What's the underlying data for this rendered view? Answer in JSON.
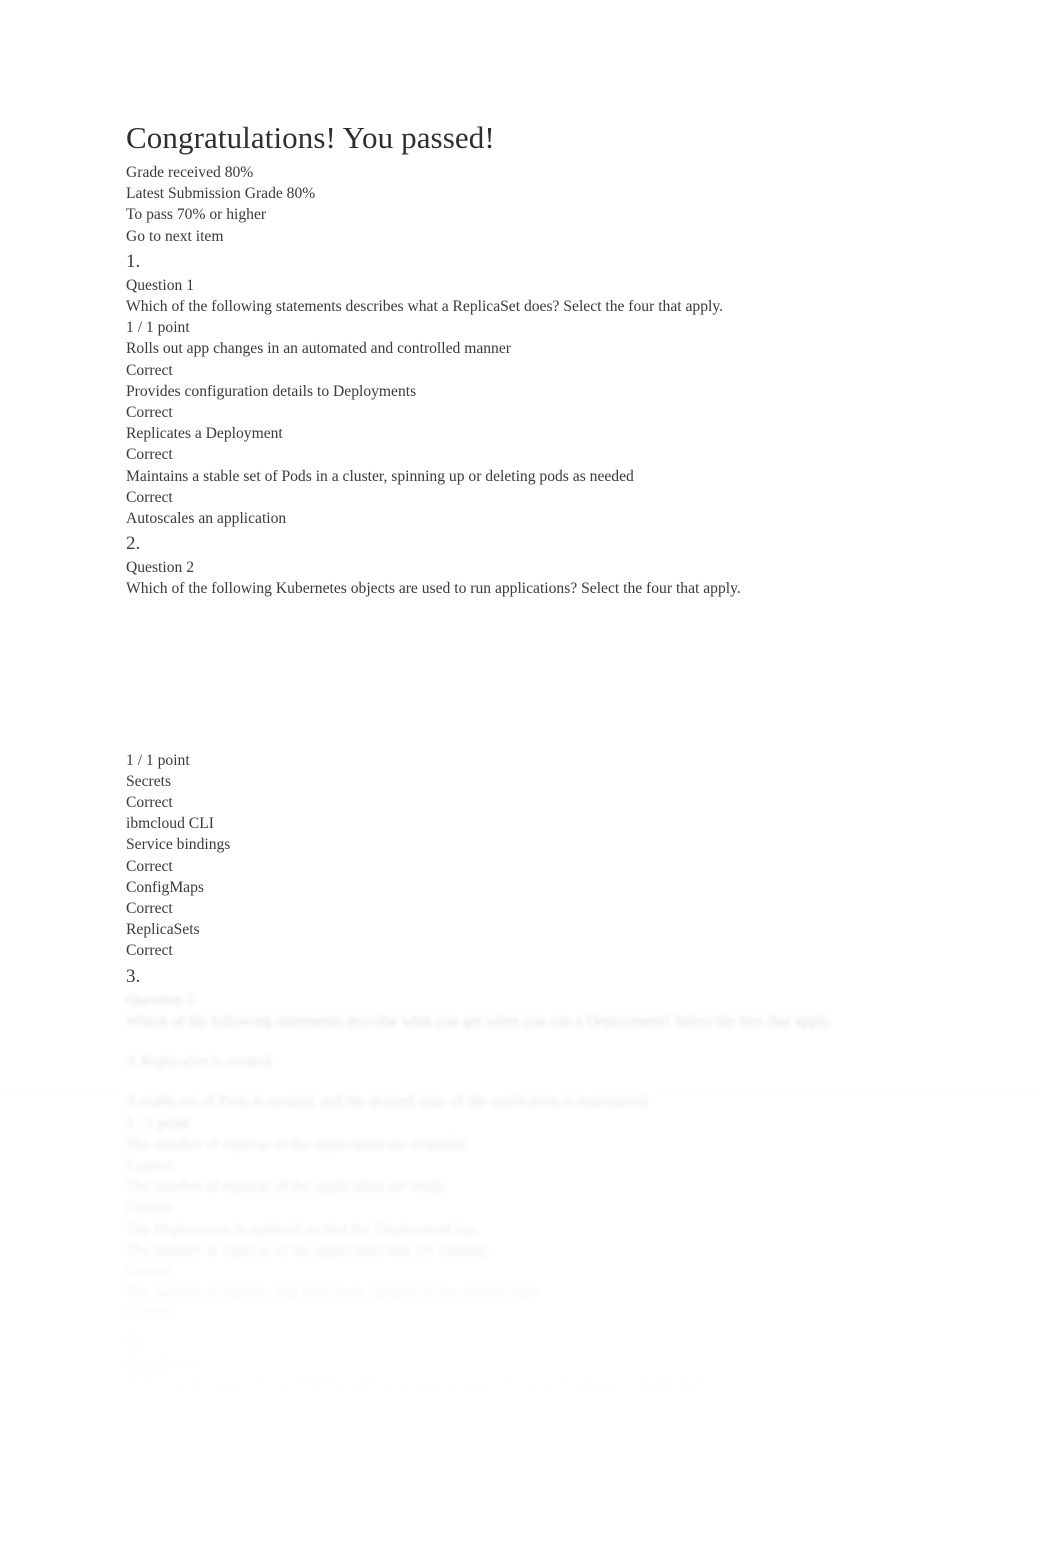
{
  "header": {
    "title": "Congratulations! You passed!",
    "grade_received": "Grade received 80%",
    "latest_submission": "Latest Submission Grade 80%",
    "to_pass": "To pass 70% or higher",
    "next_item": "Go to next item"
  },
  "questions": [
    {
      "marker": "1.",
      "label": "Question 1",
      "prompt": "Which of the following statements describes what a ReplicaSet does? Select the four that apply.",
      "points": "1 / 1 point",
      "options": [
        {
          "text": "Rolls out app changes in an automated and controlled manner",
          "status": "Correct"
        },
        {
          "text": "Provides configuration details to Deployments",
          "status": "Correct"
        },
        {
          "text": "Replicates a Deployment",
          "status": "Correct"
        },
        {
          "text": "Maintains a stable set of Pods in a cluster, spinning up or deleting pods as needed",
          "status": "Correct"
        },
        {
          "text": "Autoscales an application",
          "status": ""
        }
      ]
    },
    {
      "marker": "2.",
      "label": "Question 2",
      "prompt": "Which of the following Kubernetes objects are used to run applications? Select the four that apply.",
      "points": "1 / 1 point",
      "options": [
        {
          "text": "Secrets",
          "status": "Correct"
        },
        {
          "text": "ibmcloud CLI",
          "status": ""
        },
        {
          "text": "Service bindings",
          "status": "Correct"
        },
        {
          "text": "ConfigMaps",
          "status": "Correct"
        },
        {
          "text": "ReplicaSets",
          "status": "Correct"
        }
      ]
    },
    {
      "marker": "3.",
      "label": "Question 3",
      "prompt": "Which of the following statements describe what you get when you run a Deployment? Select the five that apply.",
      "points": "1 / 1 point",
      "subtext": "A ReplicaSet is created",
      "options": [
        {
          "text": "A stable set of Pods is created, and the desired state of the application is maintained",
          "status": "Correct"
        },
        {
          "text": "The number of replicas of the application are available",
          "status": "Correct"
        },
        {
          "text": "The number of replicas of the application are ready",
          "status": "Correct"
        },
        {
          "text": "The Deployment is updated, so that the Deployment has",
          "status": ""
        },
        {
          "text": "The number of replicas of the application that are running",
          "status": "Correct"
        },
        {
          "text": "The number of replicas that have been updated to the desired state",
          "status": "Correct"
        }
      ]
    },
    {
      "marker": "4.",
      "label": "Question 4",
      "prompt": "Which of the following Kubernetes objects is used to store and manage sensitive information?"
    }
  ]
}
